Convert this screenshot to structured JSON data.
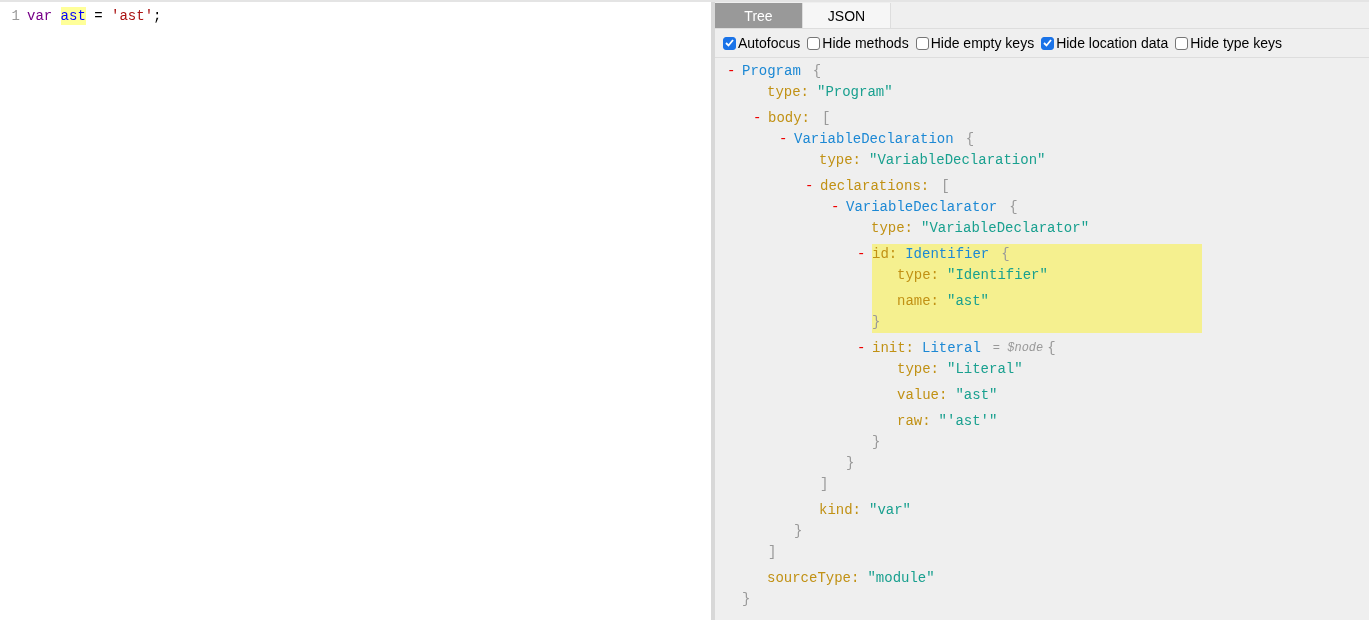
{
  "editor": {
    "lines": [
      {
        "number": "1",
        "tokens": [
          {
            "kind": "keyword",
            "text": "var ",
            "highlighted": false
          },
          {
            "kind": "variable",
            "text": "ast",
            "highlighted": true
          },
          {
            "kind": "plain",
            "text": " = ",
            "highlighted": false
          },
          {
            "kind": "string",
            "text": "'ast'",
            "highlighted": false
          },
          {
            "kind": "plain",
            "text": ";",
            "highlighted": false
          }
        ]
      }
    ]
  },
  "tabs": [
    {
      "label": "Tree",
      "selected": true
    },
    {
      "label": "JSON",
      "selected": false
    }
  ],
  "options": [
    {
      "label": "Autofocus",
      "checked": true
    },
    {
      "label": "Hide methods",
      "checked": false
    },
    {
      "label": "Hide empty keys",
      "checked": false
    },
    {
      "label": "Hide location data",
      "checked": true
    },
    {
      "label": "Hide type keys",
      "checked": false
    }
  ],
  "tree": {
    "kind": "node",
    "toggle": "-",
    "type_name": "Program",
    "open": "{",
    "close": "}",
    "highlighted": false,
    "children": [
      {
        "kind": "prop",
        "key": "type:",
        "value": "\"Program\""
      },
      {
        "kind": "array",
        "toggle": "-",
        "key": "body:",
        "open": "[",
        "close": "]",
        "highlighted": false,
        "children": [
          {
            "kind": "node",
            "toggle": "-",
            "type_name": "VariableDeclaration",
            "open": "{",
            "close": "}",
            "highlighted": false,
            "children": [
              {
                "kind": "prop",
                "key": "type:",
                "value": "\"VariableDeclaration\""
              },
              {
                "kind": "array",
                "toggle": "-",
                "key": "declarations:",
                "open": "[",
                "close": "]",
                "highlighted": false,
                "children": [
                  {
                    "kind": "node",
                    "toggle": "-",
                    "type_name": "VariableDeclarator",
                    "open": "{",
                    "close": "}",
                    "highlighted": false,
                    "children": [
                      {
                        "kind": "prop",
                        "key": "type:",
                        "value": "\"VariableDeclarator\""
                      },
                      {
                        "kind": "node",
                        "toggle": "-",
                        "key": "id:",
                        "type_name": "Identifier",
                        "open": "{",
                        "close": "}",
                        "highlighted": true,
                        "children": [
                          {
                            "kind": "prop",
                            "key": "type:",
                            "value": "\"Identifier\""
                          },
                          {
                            "kind": "prop",
                            "key": "name:",
                            "value": "\"ast\""
                          }
                        ]
                      },
                      {
                        "kind": "node",
                        "toggle": "-",
                        "key": "init:",
                        "type_name": "Literal",
                        "note": "= $node",
                        "open": "{",
                        "close": "}",
                        "highlighted": false,
                        "children": [
                          {
                            "kind": "prop",
                            "key": "type:",
                            "value": "\"Literal\""
                          },
                          {
                            "kind": "prop",
                            "key": "value:",
                            "value": "\"ast\""
                          },
                          {
                            "kind": "prop",
                            "key": "raw:",
                            "value": "\"'ast'\""
                          }
                        ]
                      }
                    ]
                  }
                ]
              },
              {
                "kind": "prop",
                "key": "kind:",
                "value": "\"var\""
              }
            ]
          }
        ]
      },
      {
        "kind": "prop",
        "key": "sourceType:",
        "value": "\"module\""
      }
    ]
  }
}
